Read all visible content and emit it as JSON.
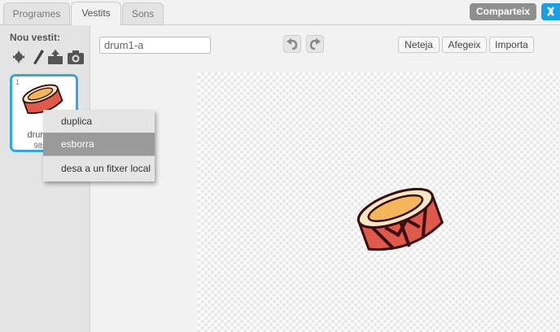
{
  "tabs": [
    {
      "label": "Programes"
    },
    {
      "label": "Vestits"
    },
    {
      "label": "Sons"
    }
  ],
  "header": {
    "share_label": "Comparteix",
    "accent": "#1aa0e0"
  },
  "sidebar": {
    "new_costume_label": "Nou vestit:",
    "new_icons": [
      "sprite-library-icon",
      "paint-brush-icon",
      "upload-icon",
      "camera-icon"
    ],
    "costume": {
      "number": "1",
      "name": "drum1-a",
      "size": "98x78"
    }
  },
  "editor": {
    "costume_name_value": "drum1-a",
    "buttons": {
      "clear": "Neteja",
      "add": "Afegeix",
      "import": "Importa"
    }
  },
  "context_menu": {
    "items": [
      {
        "label": "duplica"
      },
      {
        "label": "esborra"
      },
      {
        "label": "desa a un fitxer local"
      }
    ]
  },
  "colors": {
    "selected_border": "#33a7df",
    "share_button": "#8f8f8f",
    "menu_highlight": "#9a9a9a"
  }
}
